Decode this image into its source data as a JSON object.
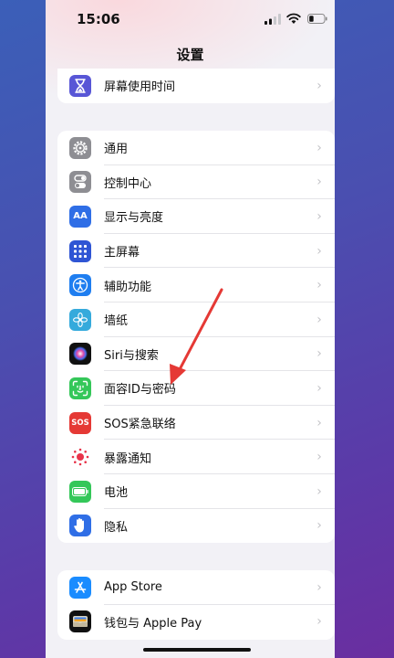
{
  "status": {
    "time": "15:06"
  },
  "nav": {
    "title": "设置"
  },
  "groups": {
    "screen_time": {
      "label": "屏幕使用时间"
    },
    "main": [
      {
        "label": "通用"
      },
      {
        "label": "控制中心"
      },
      {
        "label": "显示与亮度",
        "icon_text": "AA"
      },
      {
        "label": "主屏幕"
      },
      {
        "label": "辅助功能"
      },
      {
        "label": "墙纸"
      },
      {
        "label": "Siri与搜索"
      },
      {
        "label": "面容ID与密码"
      },
      {
        "label": "SOS紧急联络",
        "icon_text": "SOS"
      },
      {
        "label": "暴露通知"
      },
      {
        "label": "电池"
      },
      {
        "label": "隐私"
      }
    ],
    "store": [
      {
        "label": "App Store"
      },
      {
        "label": "钱包与 Apple Pay"
      }
    ]
  },
  "icons": {
    "chevron": "›"
  },
  "colors": {
    "screen_time": "#5856d6",
    "general": "#8e8e93",
    "control_center": "#8e8e93",
    "display": "#2f6ee6",
    "home_screen": "#2f55d4",
    "accessibility": "#1f7ef0",
    "wallpaper": "#35aadc",
    "face_id": "#34c759",
    "sos": "#e53935",
    "exposure": "#ffffff",
    "battery": "#34c759",
    "privacy": "#2f6ee6",
    "app_store": "#1a8cff",
    "wallet": "#111111",
    "annotation_arrow": "#e53935"
  }
}
